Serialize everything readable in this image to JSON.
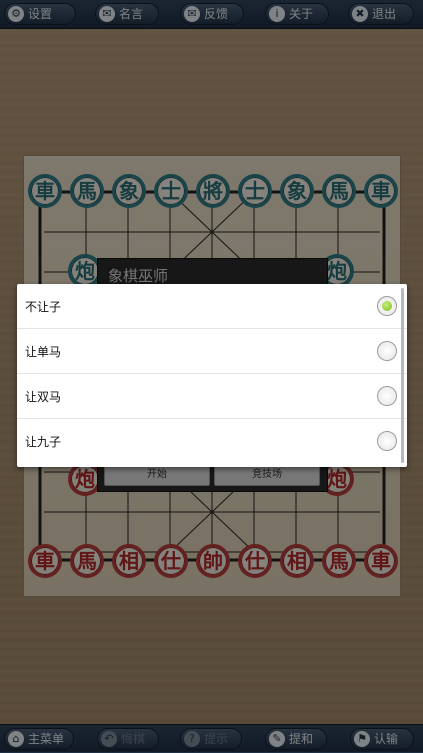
{
  "top_bar": {
    "buttons": [
      {
        "label": "设置",
        "icon": "gear-icon"
      },
      {
        "label": "名言",
        "icon": "speech-bubble-icon"
      },
      {
        "label": "反馈",
        "icon": "mail-icon"
      },
      {
        "label": "关于",
        "icon": "info-icon"
      },
      {
        "label": "退出",
        "icon": "close-icon"
      }
    ]
  },
  "board": {
    "black_back_row": [
      "車",
      "馬",
      "象",
      "士",
      "將",
      "士",
      "象",
      "馬",
      "車"
    ],
    "black_cannons": [
      "炮",
      "炮"
    ],
    "red_cannons": [
      "炮",
      "炮"
    ],
    "red_back_row": [
      "車",
      "馬",
      "相",
      "仕",
      "帥",
      "仕",
      "相",
      "馬",
      "車"
    ]
  },
  "under_dialog": {
    "title": "象棋巫师",
    "start_label": "开始",
    "arena_label": "竞技场"
  },
  "handicap_options": {
    "items": [
      {
        "label": "不让子",
        "selected": true
      },
      {
        "label": "让单马",
        "selected": false
      },
      {
        "label": "让双马",
        "selected": false
      },
      {
        "label": "让九子",
        "selected": false
      }
    ]
  },
  "bottom_bar": {
    "buttons": [
      {
        "label": "主菜单",
        "icon": "home-icon",
        "enabled": true
      },
      {
        "label": "悔棋",
        "icon": "undo-icon",
        "enabled": false
      },
      {
        "label": "提示",
        "icon": "hint-icon",
        "enabled": false
      },
      {
        "label": "提和",
        "icon": "pencil-icon",
        "enabled": true
      },
      {
        "label": "认输",
        "icon": "flag-icon",
        "enabled": true
      }
    ]
  },
  "colors": {
    "bar": "#263a50",
    "black_piece": "#2f7d86",
    "red_piece": "#b83b3b",
    "radio_selected": "#7cbb18"
  }
}
